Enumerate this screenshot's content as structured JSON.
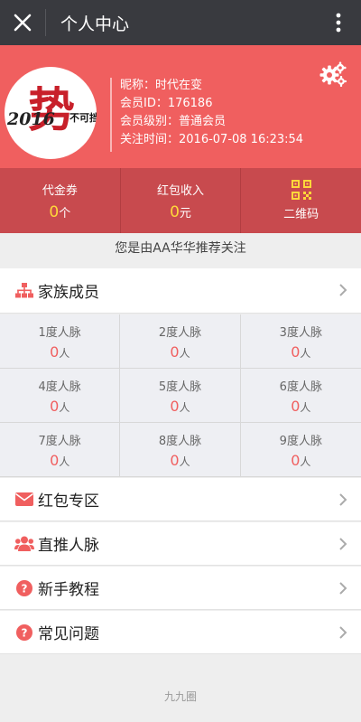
{
  "header": {
    "title": "个人中心",
    "close_icon": "close-icon",
    "more_icon": "more-vertical-icon"
  },
  "profile": {
    "nickname": "昵称：时代在变",
    "member_id": "会员ID：176186",
    "member_level": "会员级别：普通会员",
    "follow_time": "关注时间：2016-07-08 16:23:54",
    "avatar_text_year": "2016",
    "avatar_text_main": "势",
    "avatar_text_side": "不可挡",
    "settings_icon": "gears-icon"
  },
  "stats": [
    {
      "label": "代金券",
      "value": "0",
      "unit": "个"
    },
    {
      "label": "红包收入",
      "value": "0",
      "unit": "元"
    },
    {
      "label": "二维码",
      "icon": "qrcode-icon"
    }
  ],
  "referral_text": "您是由AA华华推荐关注",
  "family": {
    "label": "家族成员",
    "icon": "sitemap-icon"
  },
  "network": [
    {
      "label": "1度人脉",
      "value": "0",
      "unit": "人"
    },
    {
      "label": "2度人脉",
      "value": "0",
      "unit": "人"
    },
    {
      "label": "3度人脉",
      "value": "0",
      "unit": "人"
    },
    {
      "label": "4度人脉",
      "value": "0",
      "unit": "人"
    },
    {
      "label": "5度人脉",
      "value": "0",
      "unit": "人"
    },
    {
      "label": "6度人脉",
      "value": "0",
      "unit": "人"
    },
    {
      "label": "7度人脉",
      "value": "0",
      "unit": "人"
    },
    {
      "label": "8度人脉",
      "value": "0",
      "unit": "人"
    },
    {
      "label": "9度人脉",
      "value": "0",
      "unit": "人"
    }
  ],
  "menu": [
    {
      "label": "红包专区",
      "icon": "envelope-icon"
    },
    {
      "label": "直推人脉",
      "icon": "users-icon"
    },
    {
      "label": "新手教程",
      "icon": "question-circle-icon"
    },
    {
      "label": "常见问题",
      "icon": "question-circle-icon"
    }
  ],
  "footer": "九九圈",
  "colors": {
    "brand_red": "#f05f5f",
    "stats_red": "#c84a4e",
    "topbar": "#393a3f",
    "accent_yellow": "#ffd83a"
  }
}
